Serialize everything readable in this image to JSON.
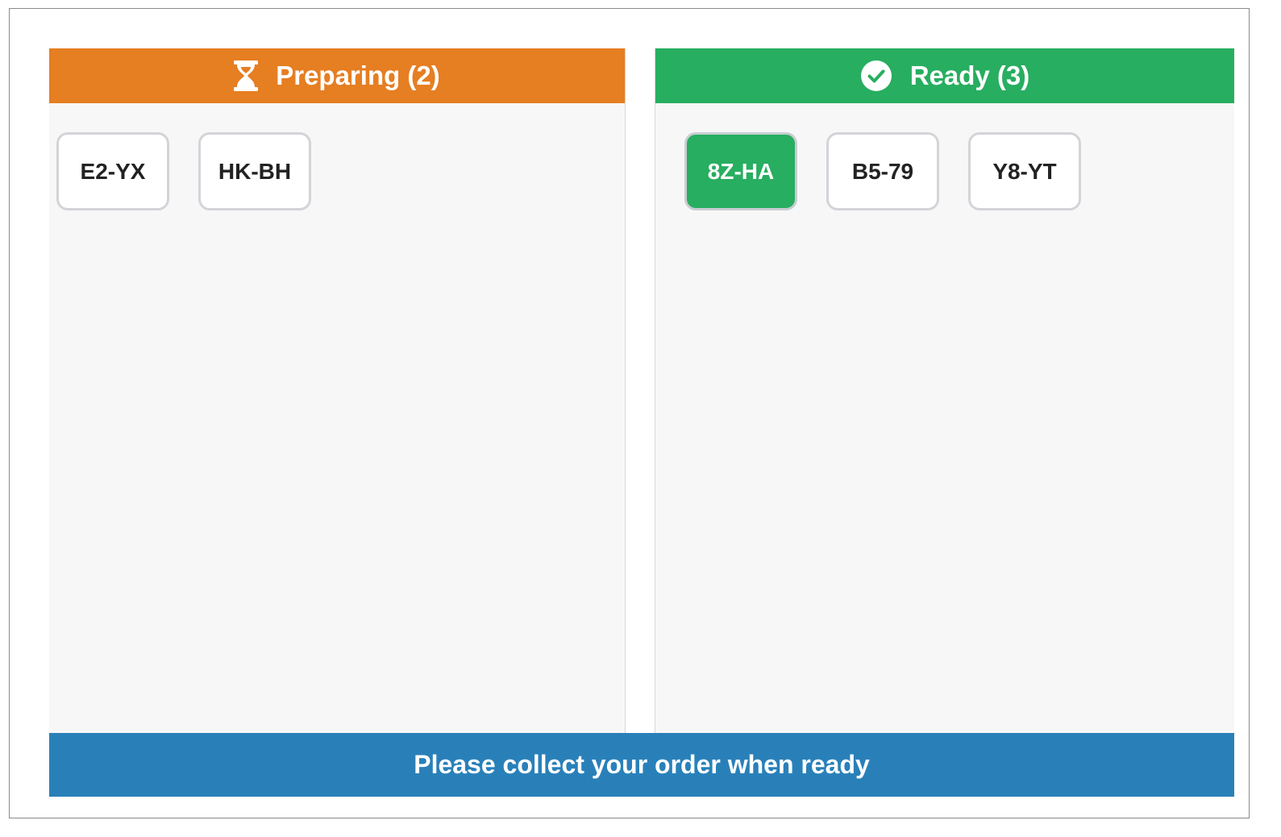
{
  "preparing": {
    "header_label": "Preparing (2)",
    "icon": "hourglass-icon",
    "color": "#e67e22",
    "orders": [
      "E2-YX",
      "HK-BH"
    ]
  },
  "ready": {
    "header_label": "Ready (3)",
    "icon": "check-circle-icon",
    "color": "#27ae60",
    "highlight_color": "#27ae60",
    "orders": [
      "8Z-HA",
      "B5-79",
      "Y8-YT"
    ],
    "highlighted_order": "8Z-HA"
  },
  "footer": {
    "message": "Please collect your order when ready",
    "color": "#2980b9"
  }
}
